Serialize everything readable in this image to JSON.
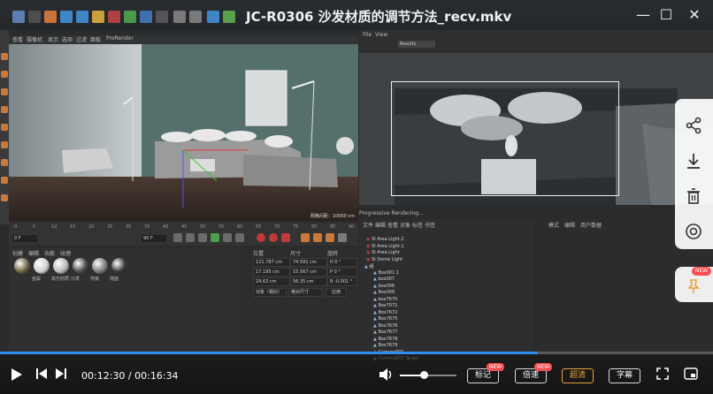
{
  "window": {
    "title": "JC-R0306 沙发材质的调节方法_recv.mkv",
    "minimize_glyph": "—",
    "maximize_glyph": "☐",
    "close_glyph": "✕"
  },
  "viewport": {
    "menu": [
      "查看",
      "摄像机",
      "显示",
      "选项",
      "过滤",
      "面板",
      "ProRender"
    ],
    "corner_label": "网格间距：10000 cm"
  },
  "render_view": {
    "menu": [
      "File",
      "View"
    ],
    "preset_label": "Results",
    "status": "Progressive Rendering..."
  },
  "timeline": {
    "ticks": [
      "0",
      "5",
      "10",
      "15",
      "20",
      "25",
      "30",
      "35",
      "40",
      "45",
      "50",
      "55",
      "60",
      "65",
      "70",
      "75",
      "80",
      "85",
      "90"
    ],
    "start_field": "0 F",
    "end_field": "90 F"
  },
  "materials": {
    "menu": [
      "创建",
      "编辑",
      "功能",
      "纹理"
    ],
    "items": [
      {
        "label": "",
        "color": "#6e6444"
      },
      {
        "label": "金属",
        "color": "#cfcfcf"
      },
      {
        "label": "高光材质",
        "color": "#b8b8b8"
      },
      {
        "label": "沙发",
        "color": "#4a4a4a"
      },
      {
        "label": "地板",
        "color": "#7a7a7a"
      },
      {
        "label": "墙面",
        "color": "#3a3a3a"
      }
    ]
  },
  "coordinates": {
    "headers": [
      "位置",
      "尺寸",
      "旋转"
    ],
    "rows": [
      [
        "121.787 cm",
        "74.591 cm",
        "H 0 °"
      ],
      [
        "17.195 cm",
        "15.567 cm",
        "P 0 °"
      ],
      [
        "24.63 cm",
        "56.35 cm",
        "B -0.001 °"
      ]
    ],
    "mode": "对象（相对）",
    "size_mode": "绝对尺寸",
    "apply": "应用"
  },
  "object_manager": {
    "menu": [
      "文件",
      "编辑",
      "查看",
      "对象",
      "标签",
      "书签"
    ],
    "rows": [
      "SI Area Light.2",
      "SI Area Light.1",
      "SI Area Light",
      "SI Dome Light",
      "组",
      "Box001.1",
      "box007",
      "box006",
      "Box006",
      "box7670",
      "Box7071",
      "Box7672",
      "Box7675",
      "Box7676",
      "Box7677",
      "Box7678",
      "Box7679",
      "Camera001",
      "Camera001 Target"
    ]
  },
  "attributes": {
    "menu": [
      "模式",
      "编辑",
      "用户数据"
    ]
  },
  "side_panel": {
    "icons": [
      "share-icon",
      "download-icon",
      "trash-icon",
      "target-icon"
    ],
    "pin_badge": "NEW"
  },
  "player": {
    "current_time": "00:12:30",
    "separator": " / ",
    "total_time": "00:16:34",
    "progress": 0.754,
    "volume": 0.42,
    "buttons": {
      "bookmark": "标记",
      "speed": "倍速",
      "quality": "超清",
      "subtitle": "字幕"
    },
    "new_badge": "NEW",
    "colors": {
      "accent": "#2f8ef0",
      "badge": "#ff4d4f"
    }
  }
}
